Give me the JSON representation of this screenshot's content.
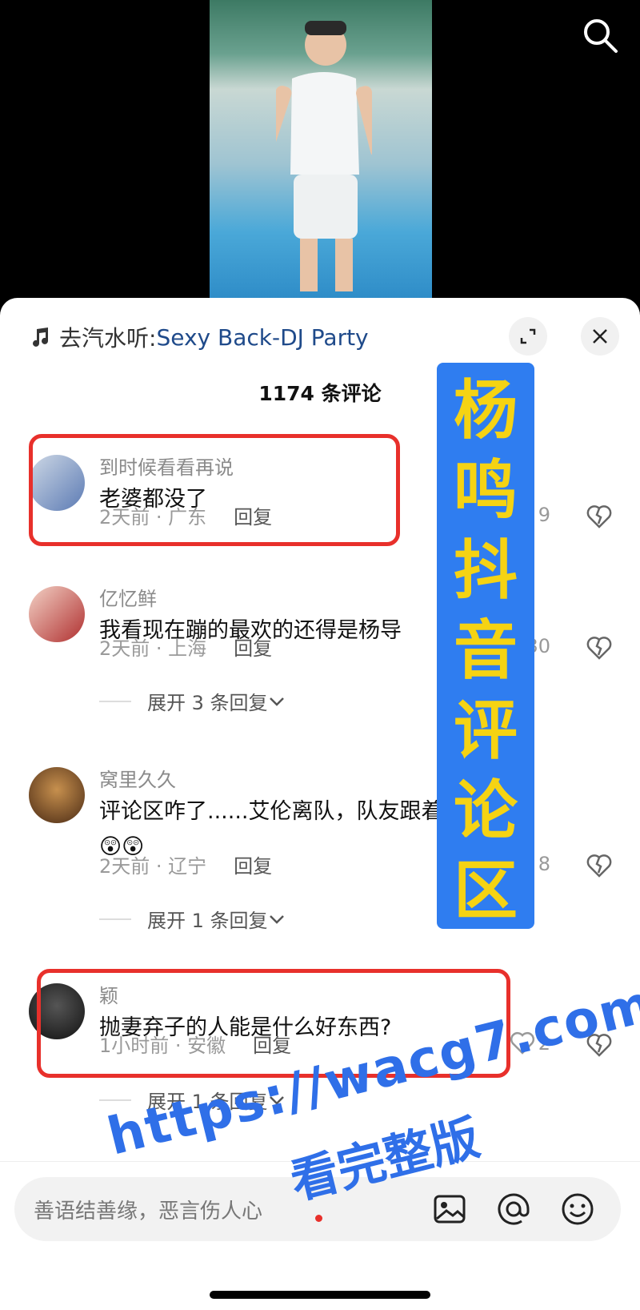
{
  "music": {
    "prefix": "去汽水听:",
    "song": "Sexy Back-DJ Party"
  },
  "comment_count": "1174 条评论",
  "comments": [
    {
      "user": "到时候看看再说",
      "text": "老婆都没了",
      "meta": "2天前 · 广东",
      "reply": "回复",
      "likes": "9"
    },
    {
      "user": "亿忆鲜",
      "text": "我看现在蹦的最欢的还得是杨导",
      "meta": "2天前 · 上海",
      "reply": "回复",
      "likes": "30",
      "expand": "展开 3 条回复"
    },
    {
      "user": "窝里久久",
      "text": "评论区咋了......艾伦离队，队友跟着挨骂😲😲😲",
      "meta": "2天前 · 辽宁",
      "reply": "回复",
      "likes": "8",
      "expand": "展开 1 条回复"
    },
    {
      "user": "颖",
      "text": "抛妻弃子的人能是什么好东西?",
      "meta": "1小时前 · 安徽",
      "reply": "回复",
      "likes": "2",
      "expand": "展开 1 条回复"
    }
  ],
  "banner": [
    "杨",
    "鸣",
    "抖",
    "音",
    "评",
    "论",
    "区"
  ],
  "input": {
    "placeholder": "善语结善缘，恶言伤人心"
  },
  "watermark": {
    "url": "https://wacg7.com",
    "sub": "看完整版"
  },
  "colors": {
    "accent_red": "#e8302b",
    "banner_blue": "#2f7df0",
    "banner_text": "#f5d313",
    "watermark": "#2f6fe8"
  }
}
